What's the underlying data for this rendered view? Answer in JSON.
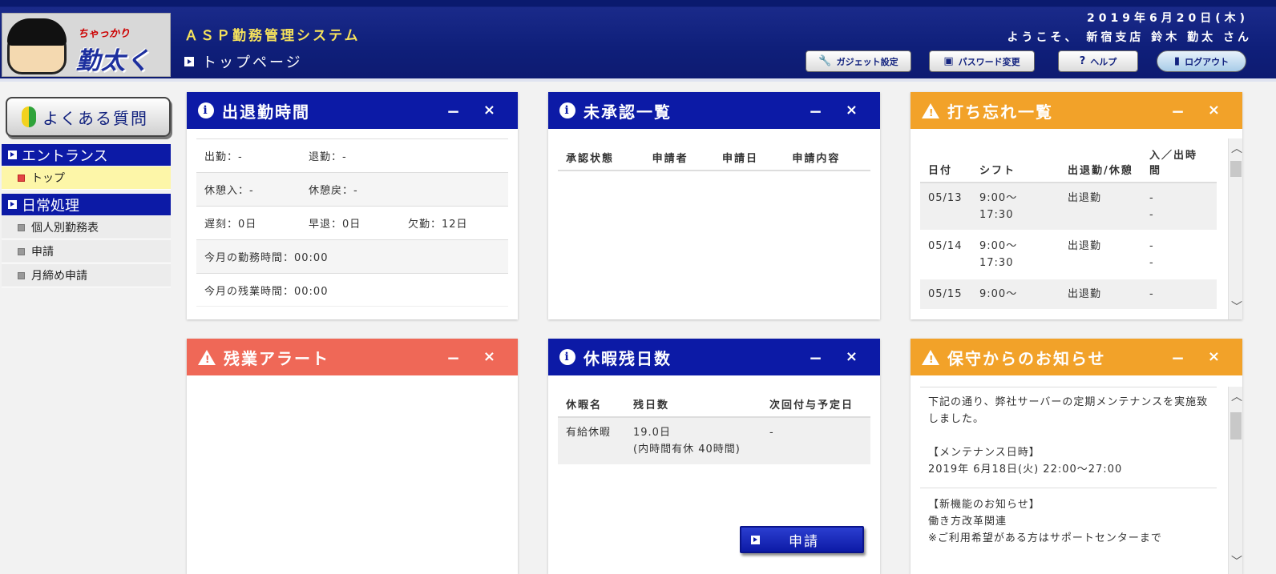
{
  "header": {
    "logo_small": "ちゃっかり",
    "logo_big": "勤太くん",
    "system_title": "ＡＳＰ勤務管理システム",
    "page_title": "トップページ",
    "date": "2019年6月20日(木)",
    "welcome": "ようこそ、 新宿支店 鈴木 勤太 さん",
    "buttons": {
      "gadget": "ガジェット設定",
      "password": "パスワード変更",
      "help": "ヘルプ",
      "logout": "ログアウト"
    }
  },
  "sidebar": {
    "faq": "よくある質問",
    "sections": [
      {
        "label": "エントランス",
        "items": [
          {
            "label": "トップ",
            "active": true
          }
        ]
      },
      {
        "label": "日常処理",
        "items": [
          {
            "label": "個人別勤務表"
          },
          {
            "label": "申請"
          },
          {
            "label": "月締め申請"
          }
        ]
      }
    ]
  },
  "panels": {
    "attendance": {
      "title": "出退勤時間",
      "rows": [
        [
          "出勤：-",
          "退勤：-",
          ""
        ],
        [
          "休憩入：-",
          "休憩戻：-",
          ""
        ],
        [
          "遅刻：0日",
          "早退：0日",
          "欠勤：12日"
        ],
        [
          "今月の勤務時間：00:00",
          "",
          ""
        ],
        [
          "今月の残業時間：00:00",
          "",
          ""
        ]
      ]
    },
    "unapproved": {
      "title": "未承認一覧",
      "headers": [
        "承認状態",
        "申請者",
        "申請日",
        "申請内容"
      ]
    },
    "forgotten": {
      "title": "打ち忘れ一覧",
      "headers": [
        "日付",
        "シフト",
        "出退勤/休憩",
        "入／出時間"
      ],
      "rows": [
        [
          "05/13",
          "9:00～\n17:30",
          "出退勤",
          "-\n-"
        ],
        [
          "05/14",
          "9:00～\n17:30",
          "出退勤",
          "-\n-"
        ],
        [
          "05/15",
          "9:00～",
          "出退勤",
          "-"
        ]
      ]
    },
    "overtime": {
      "title": "残業アラート"
    },
    "leave": {
      "title": "休暇残日数",
      "headers": [
        "休暇名",
        "残日数",
        "次回付与予定日"
      ],
      "rows": [
        [
          "有給休暇",
          "19.0日\n(内時間有休 40時間)",
          "-"
        ]
      ],
      "apply_button": "申請"
    },
    "maintenance": {
      "title": "保守からのお知らせ",
      "notice1": [
        "下記の通り、弊社サーバーの定期メンテナンスを実施致しました。",
        "",
        "【メンテナンス日時】",
        "2019年 6月18日(火) 22:00～27:00"
      ],
      "notice2": [
        "【新機能のお知らせ】",
        "働き方改革関連",
        "※ご利用希望がある方はサポートセンターまで"
      ]
    }
  },
  "colors": {
    "nav_blue": "#0c1aa6",
    "header_blue": "#0f1f7a",
    "warn_orange": "#f2a229",
    "alert_red": "#ef6857",
    "active_yellow": "#fdf6a8"
  }
}
